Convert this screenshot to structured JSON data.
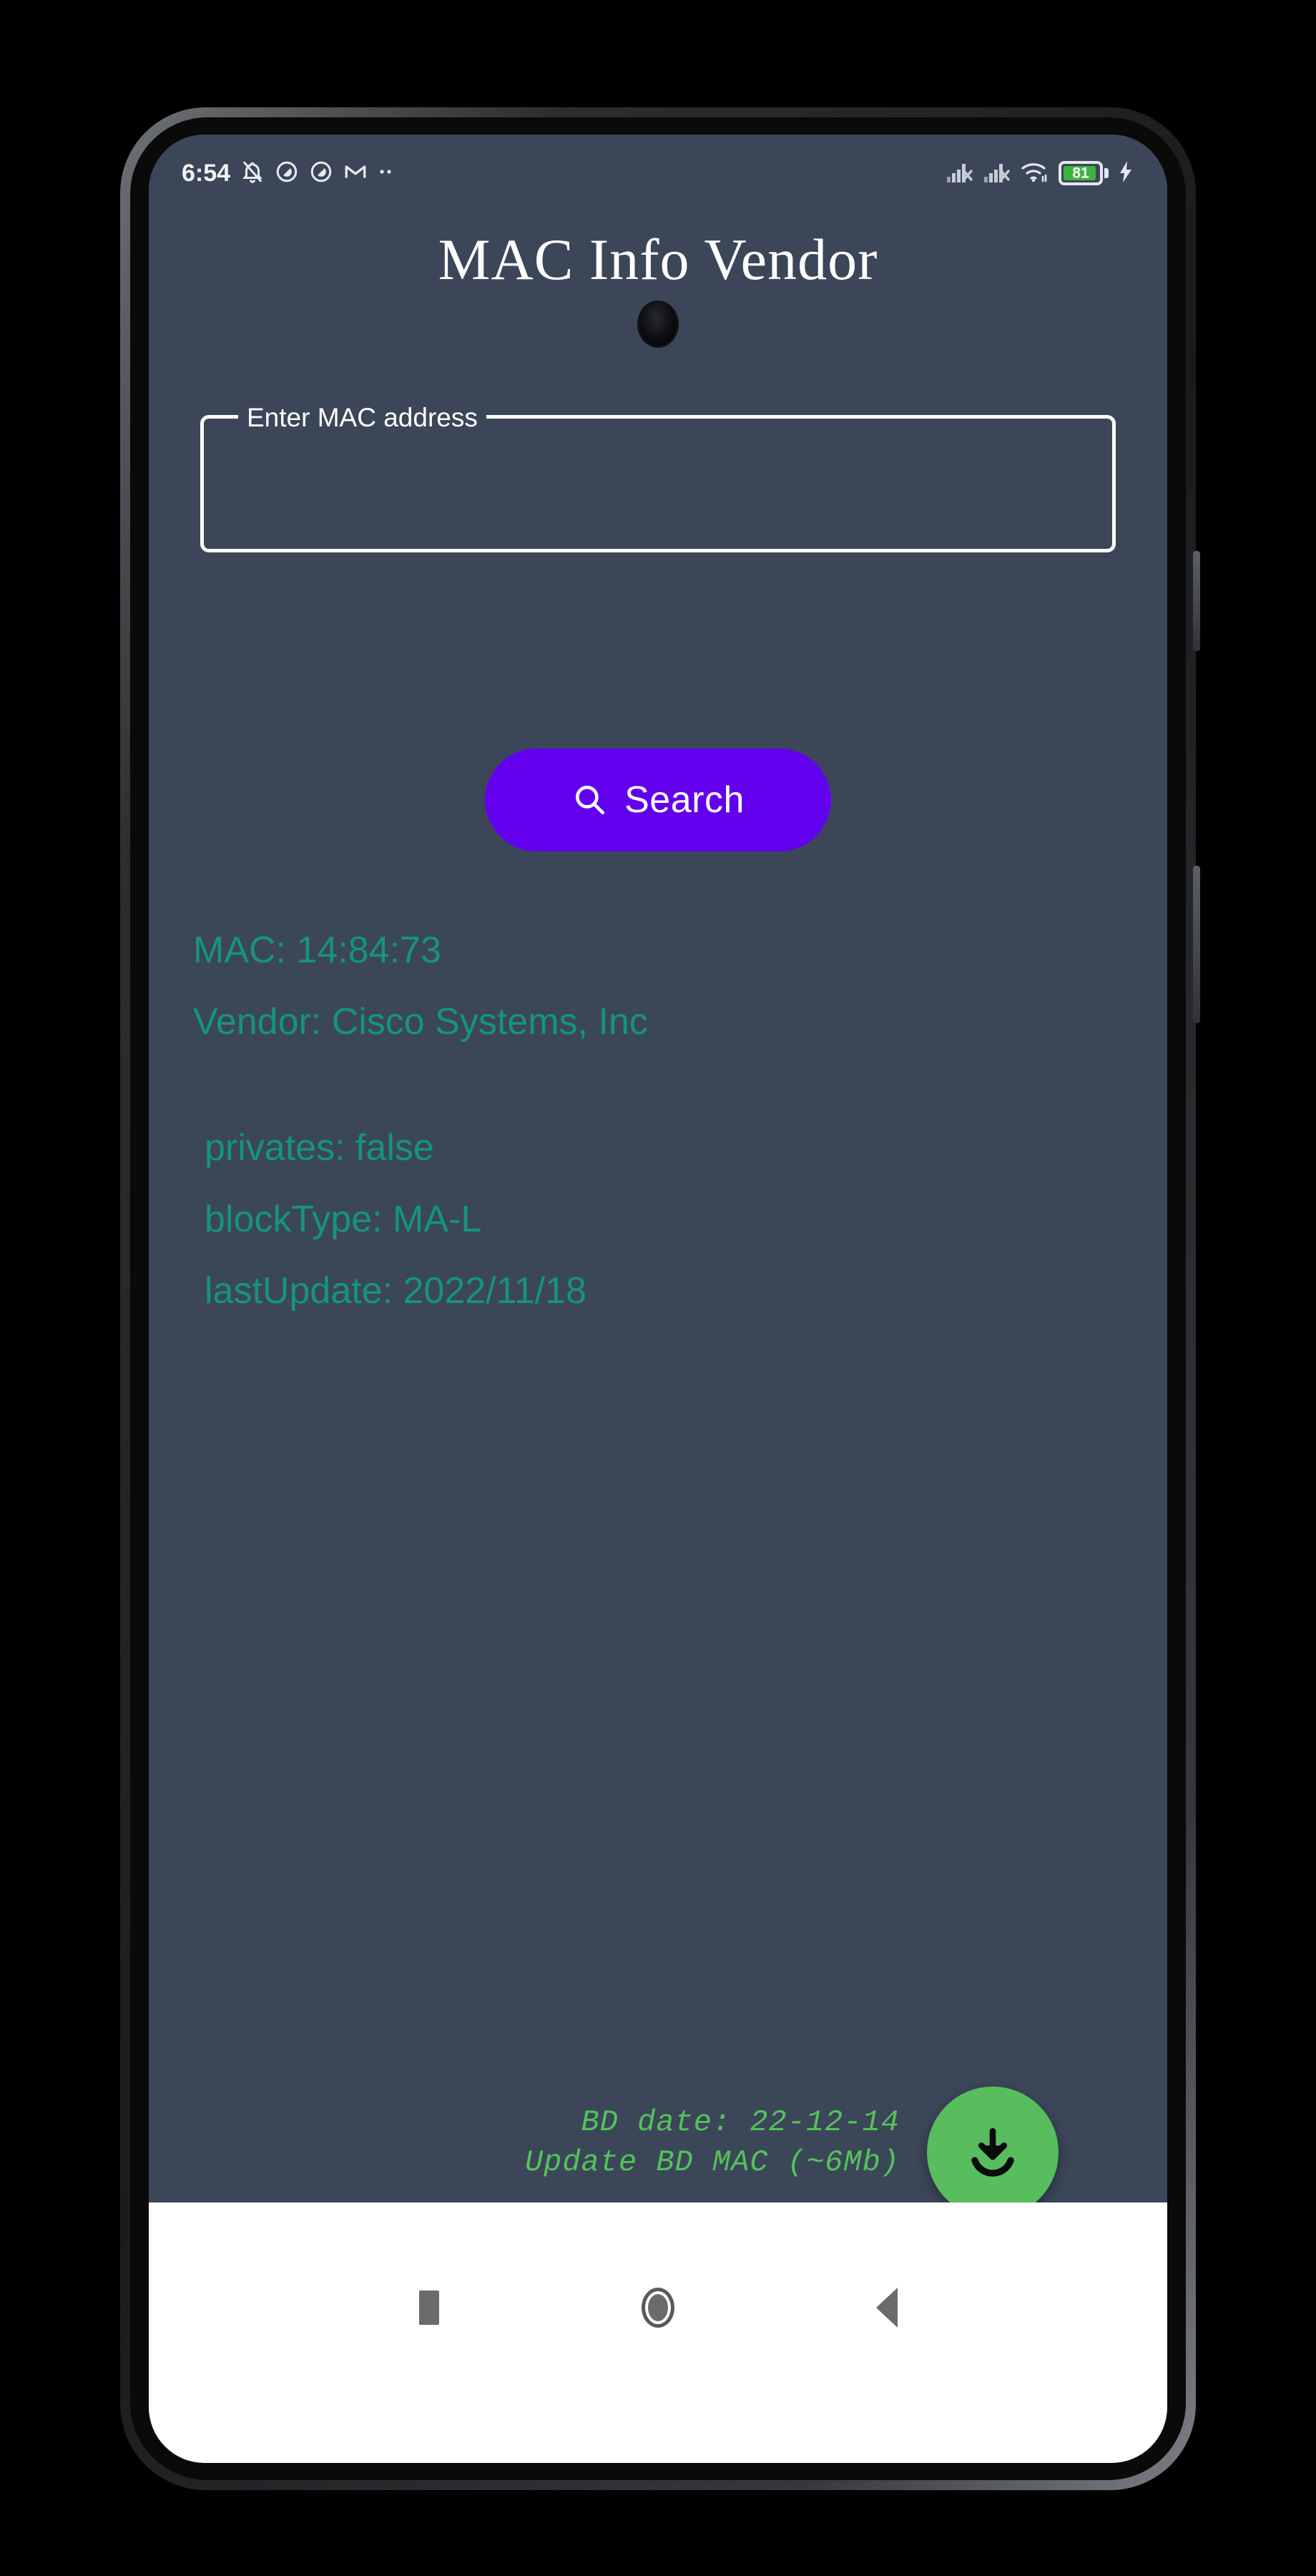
{
  "status_bar": {
    "clock": "6:54",
    "left_icons": [
      {
        "name": "notifications-off-icon",
        "glyph": "bell-muted"
      },
      {
        "name": "do-not-disturb-icon",
        "glyph": "circle-slash"
      },
      {
        "name": "do-not-disturb-secondary-icon",
        "glyph": "circle-slash"
      },
      {
        "name": "gmail-icon",
        "glyph": "M"
      },
      {
        "name": "more-notifications-icon",
        "glyph": "dots"
      }
    ],
    "right_icons": [
      {
        "name": "signal-sim1-no-service-icon",
        "glyph": "bars-x"
      },
      {
        "name": "signal-sim2-no-service-icon",
        "glyph": "bars-x"
      },
      {
        "name": "wifi-icon",
        "glyph": "wifi"
      }
    ],
    "battery": {
      "level_text": "81",
      "level_percent": 81,
      "charging": true,
      "fill_color": "#3fb33f"
    }
  },
  "app": {
    "title": "MAC Info Vendor",
    "background_color": "#3c4659"
  },
  "mac_field": {
    "label": "Enter MAC address",
    "value": "",
    "placeholder": ""
  },
  "search_button": {
    "label": "Search",
    "icon": "search-icon",
    "color": "#6200ee"
  },
  "results": {
    "accent_color": "#14947d",
    "primary": [
      "MAC: 14:84:73",
      "Vendor: Cisco Systems, Inc"
    ],
    "details": [
      "privates: false",
      "blockType: MA-L",
      "lastUpdate: 2022/11/18"
    ]
  },
  "update_bd": {
    "date_line": "BD date: 22-12-14",
    "action_line": "Update BD MAC (~6Mb)",
    "text_color": "#53c35a",
    "fab": {
      "icon": "download-icon",
      "color": "#57bd5d"
    }
  },
  "nav_bar": {
    "buttons": [
      {
        "name": "nav-recents-button",
        "glyph": "square"
      },
      {
        "name": "nav-home-button",
        "glyph": "circle"
      },
      {
        "name": "nav-back-button",
        "glyph": "triangle-left"
      }
    ]
  }
}
